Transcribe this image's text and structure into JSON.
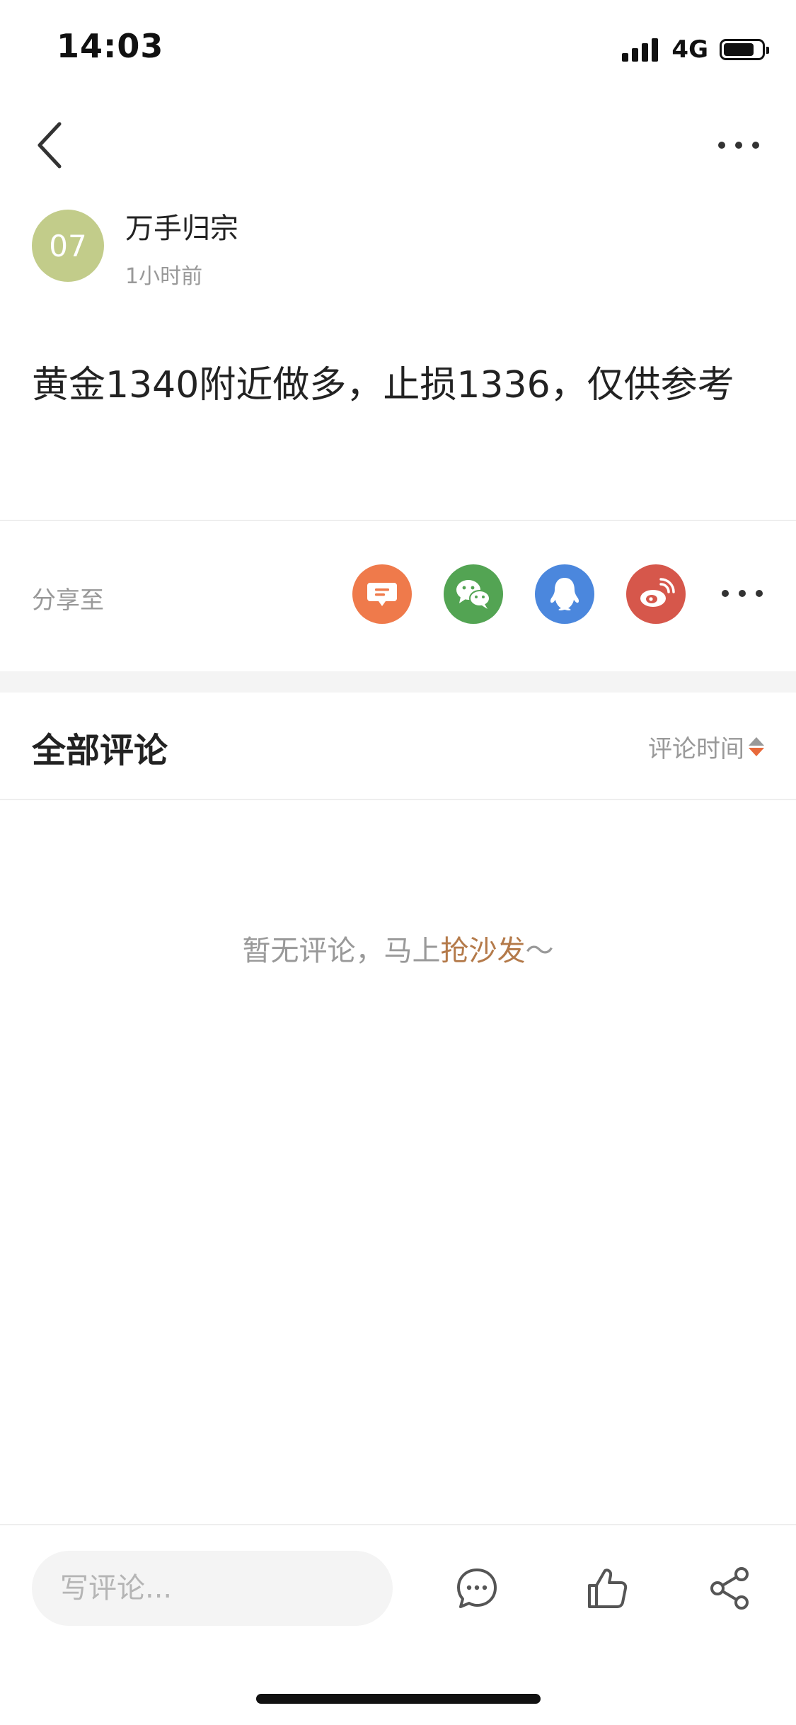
{
  "status_bar": {
    "time": "14:03",
    "network": "4G",
    "battery_level": 0.8
  },
  "nav": {
    "back_icon": "chevron-left-icon",
    "more_icon": "more-horizontal-icon"
  },
  "author": {
    "avatar_text": "07",
    "avatar_color": "#c2cc8a",
    "name": "万手归宗",
    "time": "1小时前"
  },
  "post": {
    "content": "黄金1340附近做多，止损1336，仅供参考"
  },
  "share": {
    "label": "分享至",
    "targets": [
      {
        "icon": "message-icon",
        "color": "#ef7a4b"
      },
      {
        "icon": "wechat-icon",
        "color": "#53a453"
      },
      {
        "icon": "qq-icon",
        "color": "#4b87dd"
      },
      {
        "icon": "weibo-icon",
        "color": "#d6574b"
      }
    ],
    "more_icon": "more-horizontal-icon"
  },
  "comments": {
    "title": "全部评论",
    "sort_label": "评论时间",
    "empty_text": "暂无评论，马上",
    "empty_link": "抢沙发",
    "empty_suffix": "～"
  },
  "bottom_bar": {
    "input_placeholder": "写评论...",
    "icons": [
      "comment-icon",
      "thumbs-up-icon",
      "share-icon"
    ]
  },
  "colors": {
    "accent": "#e8693a",
    "link": "#b47a4a",
    "muted": "#999999"
  }
}
